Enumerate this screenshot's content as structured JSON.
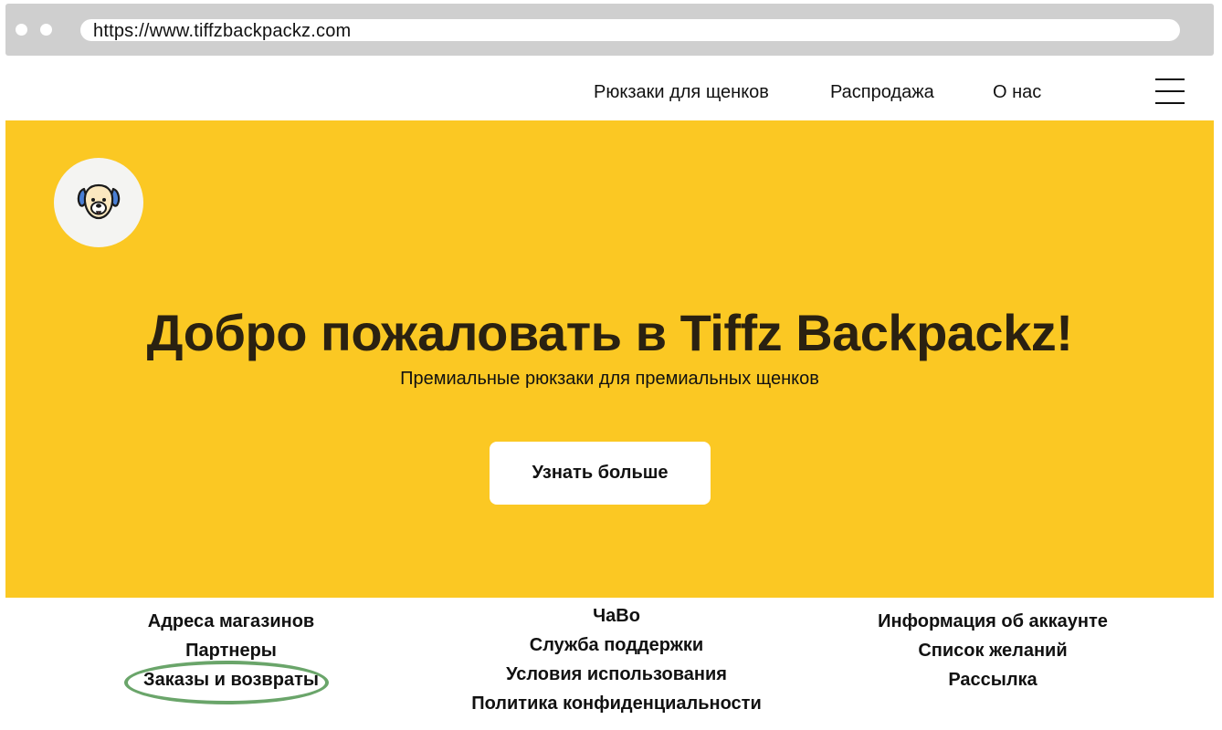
{
  "browser": {
    "url": "https://www.tiffzbackpackz.com"
  },
  "nav": {
    "links": [
      "Рюкзаки для щенков",
      "Распродажа",
      "О нас"
    ],
    "menu_icon": "hamburger-icon"
  },
  "hero": {
    "logo_icon": "dog-face-icon",
    "title": "Добро пожаловать в Tiffz Backpackz!",
    "subtitle": "Премиальные рюкзаки для премиальных щенков",
    "button_label": "Узнать больше",
    "background_color": "#fbc823"
  },
  "footer": {
    "col1": [
      "Адреса магазинов",
      "Партнеры",
      "Заказы и возвраты"
    ],
    "col2": [
      "ЧаВо",
      "Служба поддержки",
      "Условия использования",
      "Политика конфиденциальности"
    ],
    "col3": [
      "Информация об аккаунте",
      "Список желаний",
      "Рассылка"
    ]
  },
  "annotation": {
    "highlighted_item": "Заказы и возвраты",
    "highlight_color": "#6aa56a"
  }
}
